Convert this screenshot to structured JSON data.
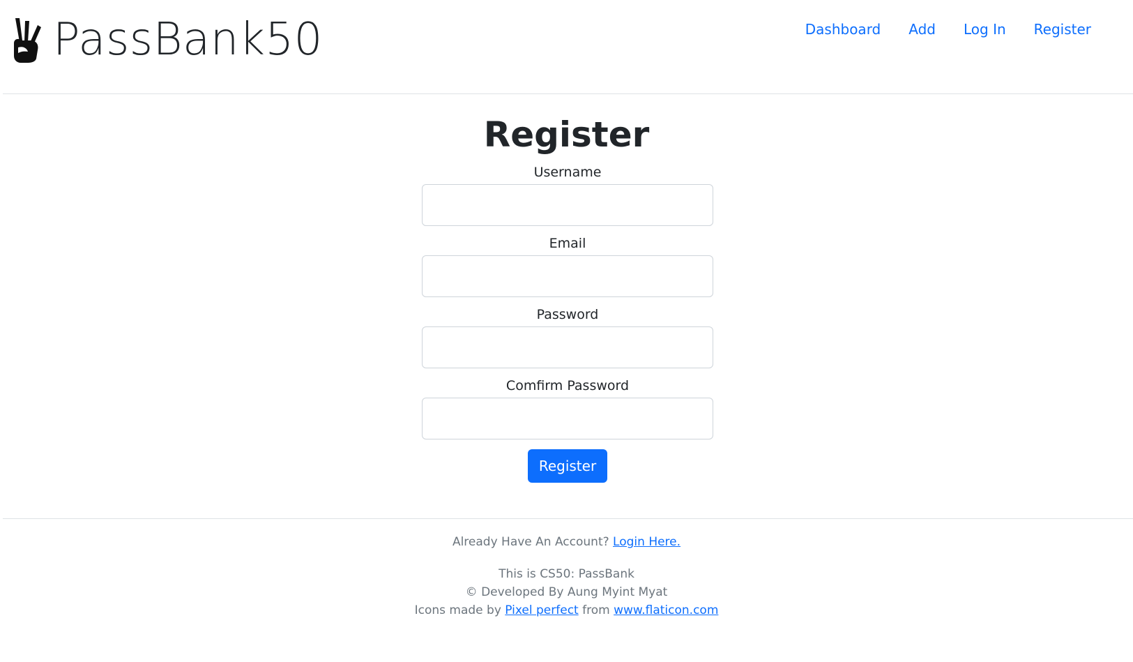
{
  "brand": {
    "title": "PassBank50",
    "icon": "three-fingers-hand-icon"
  },
  "nav": {
    "dashboard": "Dashboard",
    "add": "Add",
    "login": "Log In",
    "register": "Register"
  },
  "form": {
    "title": "Register",
    "username_label": "Username",
    "username_value": "",
    "email_label": "Email",
    "email_value": "",
    "password_label": "Password",
    "password_value": "",
    "confirm_label": "Comfirm Password",
    "confirm_value": "",
    "submit_label": "Register"
  },
  "footer": {
    "have_account": "Already Have An Account?",
    "login_link": "Login Here.",
    "about": "This is CS50: PassBank",
    "developer": "© Developed By Aung Myint Myat",
    "icons_prefix": "Icons made by",
    "icons_author": "Pixel perfect",
    "icons_from": "from",
    "icons_site": "www.flaticon.com"
  },
  "colors": {
    "accent": "#0d6efd",
    "text": "#212529",
    "muted": "#6c757d",
    "border": "#dee2e6"
  }
}
